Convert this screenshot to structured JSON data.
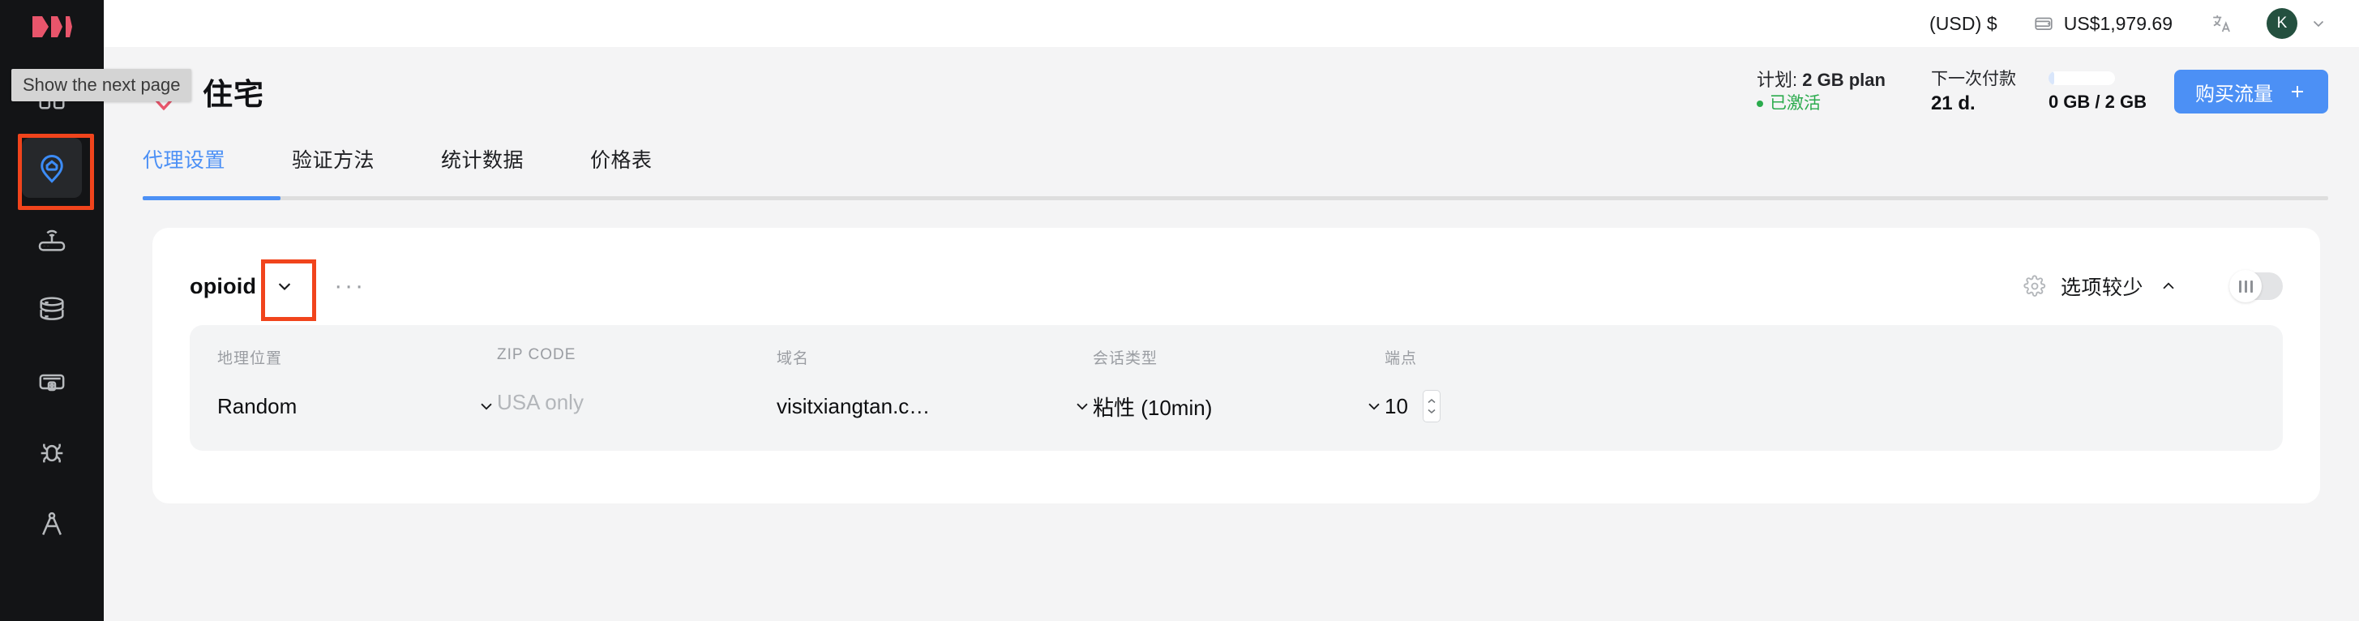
{
  "tooltip": {
    "text": "Show the next page"
  },
  "sidebar": {
    "logo_name": "brand-logo",
    "items": [
      {
        "name": "grid-icon",
        "label": ""
      },
      {
        "name": "residential-icon",
        "label": "",
        "active": true
      },
      {
        "name": "router-icon",
        "label": ""
      },
      {
        "name": "datacenter-icon",
        "label": ""
      },
      {
        "name": "mobile-proxy-icon",
        "label": ""
      },
      {
        "name": "bug-icon",
        "label": ""
      },
      {
        "name": "compass-icon",
        "label": ""
      }
    ]
  },
  "topbar": {
    "currency": "(USD) $",
    "balance": "US$1,979.69",
    "wallet_icon": "wallet-icon",
    "language_icon": "translate-icon",
    "avatar_initial": "K",
    "chevron_icon": "chevron-down-icon"
  },
  "header": {
    "title": "住宅",
    "icon": "home-pin-icon",
    "plan_label": "计划:",
    "plan_name": "2 GB plan",
    "status": "已激活",
    "status_color": "#2bab4d",
    "next_payment_label": "下一次付款",
    "next_payment_value": "21 d.",
    "usage_text": "0 GB / 2 GB",
    "usage_percent": 0,
    "buy_button": "购买流量",
    "buy_button_icon": "plus-icon"
  },
  "tabs": [
    {
      "label": "代理设置",
      "active": true
    },
    {
      "label": "验证方法",
      "active": false
    },
    {
      "label": "统计数据",
      "active": false
    },
    {
      "label": "价格表",
      "active": false
    }
  ],
  "card": {
    "proxy_name": "opioid",
    "name_caret_icon": "chevron-down-icon",
    "more_menu": "···",
    "gear_icon": "gear-icon",
    "fewer_options_label": "选项较少",
    "fewer_options_caret": "chevron-up-icon",
    "toggle_on": false,
    "fields": [
      {
        "name": "geo-location",
        "label": "地理位置",
        "value": "Random",
        "placeholder": "",
        "control": "select"
      },
      {
        "name": "zip-code",
        "label": "ZIP CODE",
        "value": "",
        "placeholder": "USA only",
        "control": "input"
      },
      {
        "name": "domain",
        "label": "域名",
        "value": "visitxiangtan.c…",
        "placeholder": "",
        "control": "select"
      },
      {
        "name": "session-type",
        "label": "会话类型",
        "value": "粘性 (10min)",
        "placeholder": "",
        "control": "select"
      },
      {
        "name": "endpoints",
        "label": "端点",
        "value": "10",
        "placeholder": "",
        "control": "number"
      }
    ]
  },
  "colors": {
    "accent": "#4c90f5",
    "brand_red": "#e8556b",
    "highlight": "#f1441c",
    "sidebar_bg": "#131416",
    "page_bg": "#f4f4f5"
  }
}
